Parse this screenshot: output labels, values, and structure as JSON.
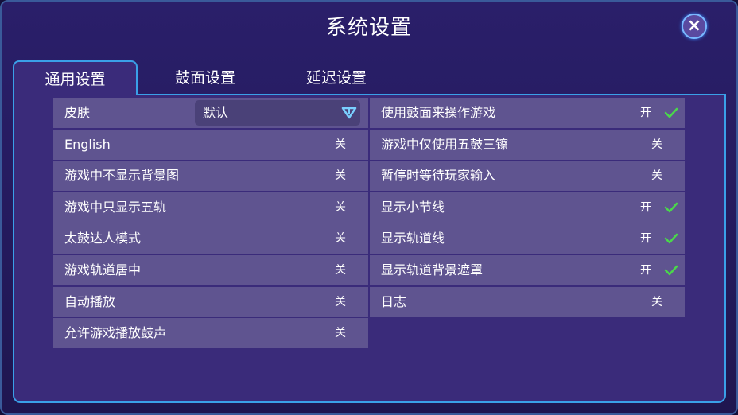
{
  "title": "系统设置",
  "close_label": "×",
  "tabs": [
    {
      "label": "通用设置",
      "active": true
    },
    {
      "label": "鼓面设置",
      "active": false
    },
    {
      "label": "延迟设置",
      "active": false
    }
  ],
  "left_options": [
    {
      "label": "皮肤",
      "value": "默认",
      "type": "dropdown"
    },
    {
      "label": "English",
      "value": "关"
    },
    {
      "label": "游戏中不显示背景图",
      "value": "关"
    },
    {
      "label": "游戏中只显示五轨",
      "value": "关"
    },
    {
      "label": "太鼓达人模式",
      "value": "关"
    },
    {
      "label": "游戏轨道居中",
      "value": "关"
    },
    {
      "label": "自动播放",
      "value": "关"
    },
    {
      "label": "允许游戏播放鼓声",
      "value": "关"
    }
  ],
  "right_options": [
    {
      "label": "使用鼓面来操作游戏",
      "value": "开",
      "checked": true
    },
    {
      "label": "游戏中仅使用五鼓三镲",
      "value": "关",
      "checked": false
    },
    {
      "label": "暂停时等待玩家输入",
      "value": "关",
      "checked": false
    },
    {
      "label": "显示小节线",
      "value": "开",
      "checked": true
    },
    {
      "label": "显示轨道线",
      "value": "开",
      "checked": true
    },
    {
      "label": "显示轨道背景遮罩",
      "value": "开",
      "checked": true
    },
    {
      "label": "日志",
      "value": "关",
      "checked": false
    }
  ],
  "colors": {
    "accent": "#3aa0e8",
    "check": "#4ad84a",
    "row_bg": "#5f5490",
    "panel_bg": "#3a2b7a"
  },
  "icons": {
    "close": "close-icon",
    "dropdown": "chevron-down-icon",
    "check": "checkmark-icon"
  }
}
